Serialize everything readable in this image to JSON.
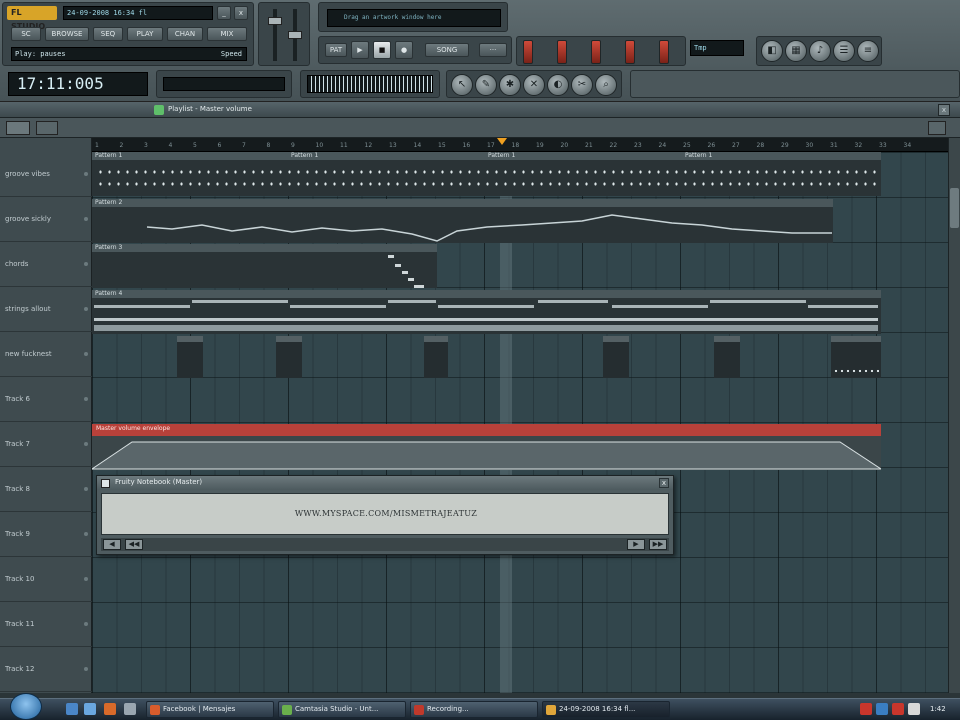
{
  "toolbar": {
    "title_lcd": "24-09-2008 16:34 fl",
    "hint": "Play: pauses",
    "hint_right": "Speed",
    "song_time": "17:11:005",
    "info_lcd": "Drag an artwork window here",
    "tempo_lcd": "Tmp",
    "lcd_buttons": [
      "SC",
      "BROWSE",
      "SEQ",
      "PLAY",
      "CHAN",
      "MIX"
    ],
    "transport": [
      "PAT",
      "SONG"
    ]
  },
  "playlist": {
    "title": "Playlist - Master volume",
    "timeline": [
      "1",
      "2",
      "3",
      "4",
      "5",
      "6",
      "7",
      "8",
      "9",
      "10",
      "11",
      "12",
      "13",
      "14",
      "15",
      "16",
      "17",
      "18",
      "19",
      "20",
      "21",
      "22",
      "23",
      "24",
      "25",
      "26",
      "27",
      "28",
      "29",
      "30",
      "31",
      "32",
      "33",
      "34"
    ],
    "tracks": [
      {
        "name": "groove vibes"
      },
      {
        "name": "groove sickly"
      },
      {
        "name": "chords"
      },
      {
        "name": "strings allout"
      },
      {
        "name": "new fucknest"
      },
      {
        "name": "Track 6"
      },
      {
        "name": "Track 7"
      },
      {
        "name": "Track 8"
      },
      {
        "name": "Track 9"
      },
      {
        "name": "Track 10"
      },
      {
        "name": "Track 11"
      },
      {
        "name": "Track 12"
      }
    ],
    "clips": [
      {
        "label": "Pattern 1"
      },
      {
        "label": "Pattern 1"
      },
      {
        "label": "Pattern 1"
      },
      {
        "label": "Pattern 1"
      },
      {
        "label": "Pattern 2"
      },
      {
        "label": "Pattern 3"
      },
      {
        "label": "Pattern 4"
      }
    ],
    "automation_label": "Master volume envelope"
  },
  "dialog": {
    "title": "Fruity Notebook (Master)",
    "text": "WWW.MYSPACE.COM/MISMETRAJEATUZ",
    "close": "x"
  },
  "taskbar": {
    "tasks": [
      {
        "label": "Facebook | Mensajes"
      },
      {
        "label": "Camtasia Studio - Unt..."
      },
      {
        "label": "Recording..."
      },
      {
        "label": "24-09-2008 16:34 fl..."
      }
    ],
    "clock": "1:42"
  }
}
